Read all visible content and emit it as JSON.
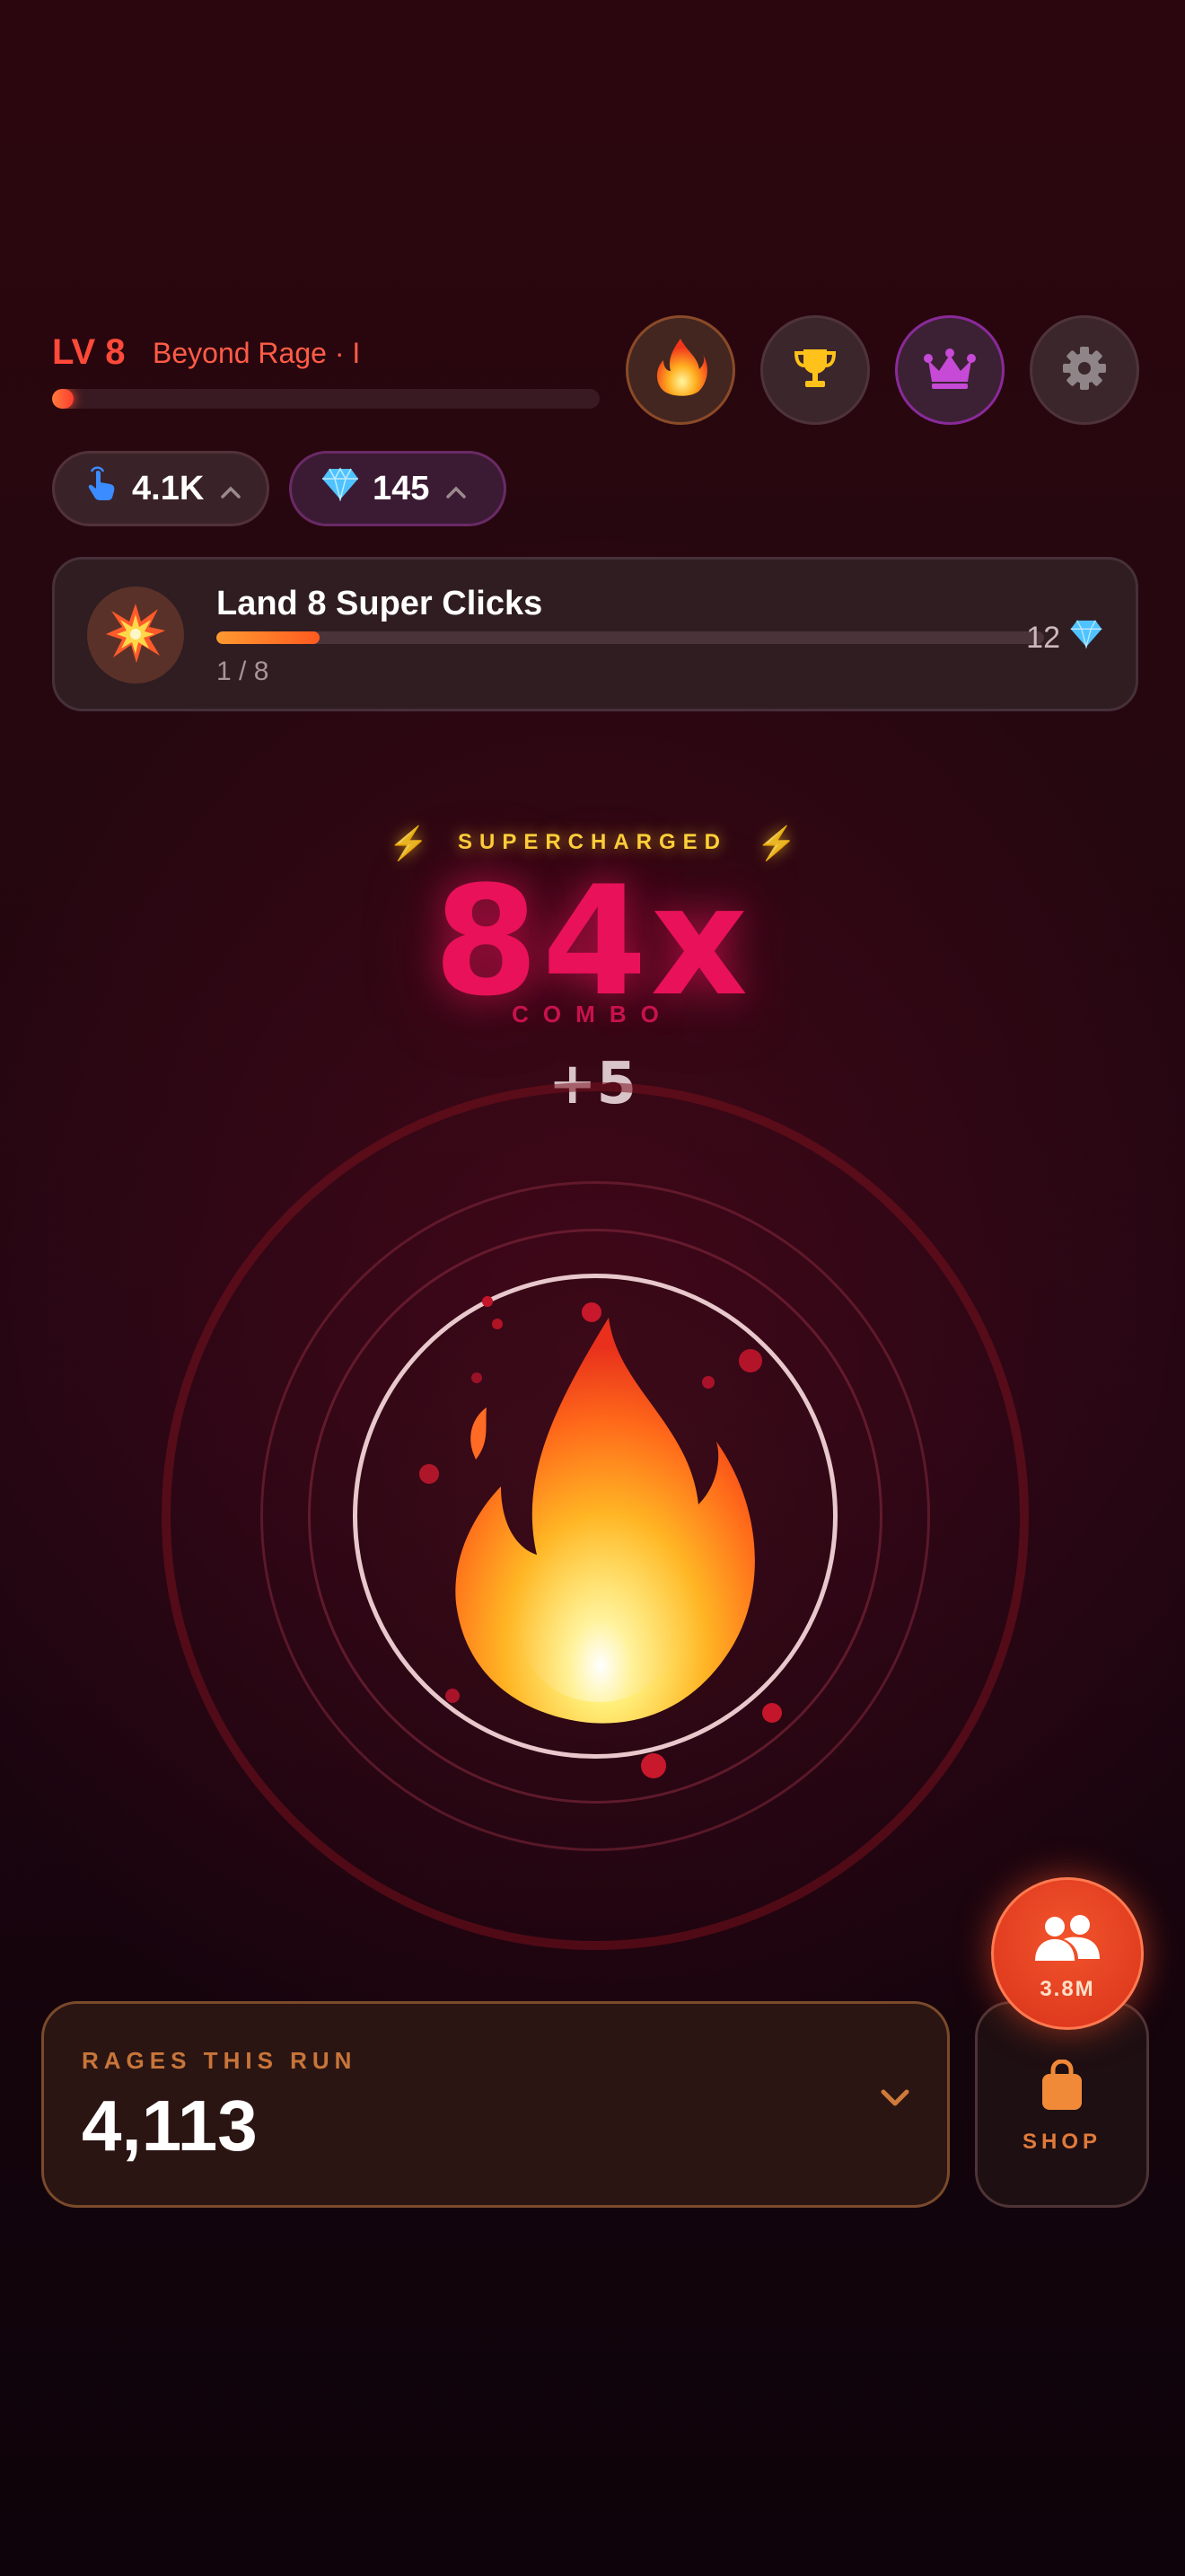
{
  "header": {
    "level": "LV 8",
    "rank": "Beyond Rage · I",
    "xp_progress": 0.04,
    "buttons": [
      {
        "name": "streak",
        "icon": "fire-icon"
      },
      {
        "name": "leaderboard",
        "icon": "trophy-icon"
      },
      {
        "name": "premium",
        "icon": "crown-icon"
      },
      {
        "name": "settings",
        "icon": "gear-icon"
      }
    ]
  },
  "currencies": {
    "taps": {
      "icon": "tap-hand-icon",
      "value": "4.1K"
    },
    "gems": {
      "icon": "gem-icon",
      "value": "145"
    }
  },
  "quest": {
    "icon": "explosion-icon",
    "title": "Land 8 Super Clicks",
    "progress_text": "1 / 8",
    "progress": 0.125,
    "reward": "12",
    "reward_icon": "gem-icon"
  },
  "combo": {
    "status": "SUPERCHARGED",
    "value": "84x",
    "label": "COMBO",
    "gain": "+5"
  },
  "tap_target": {
    "icon": "fire-emoji-icon"
  },
  "rages": {
    "label": "RAGES THIS RUN",
    "value": "4,113"
  },
  "friends": {
    "count": "3.8M"
  },
  "shop": {
    "label": "SHOP"
  },
  "colors": {
    "accent": "#ff4a3a",
    "combo": "#e8115a",
    "gold": "#ffd23a",
    "background": "#220612"
  }
}
